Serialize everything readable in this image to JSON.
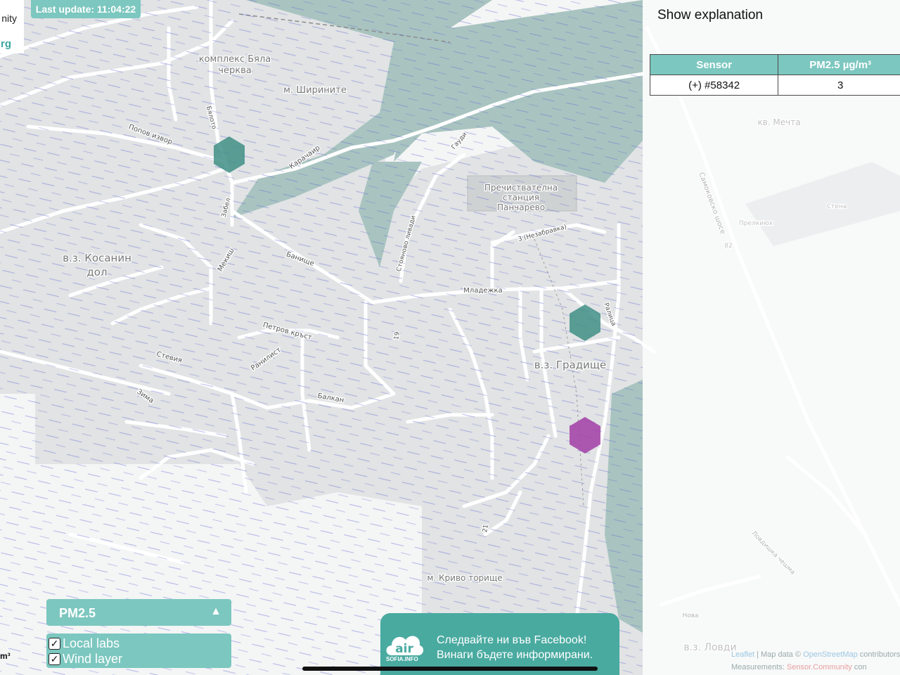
{
  "last_update": "Last update: 11:04:22",
  "info_box": {
    "line1": "nity",
    "line2": "rg"
  },
  "left_unit": "m³",
  "sidebar": {
    "show_explanation": "Show explanation",
    "table": {
      "headers": [
        "Sensor",
        "PM2.5 µg/m³"
      ],
      "rows": [
        [
          "(+) #58342",
          "3"
        ]
      ]
    }
  },
  "controls": {
    "pollutant": "PM2.5",
    "arrow": "▲",
    "layers": [
      {
        "label": "Local labs",
        "checked": true
      },
      {
        "label": "Wind layer",
        "checked": true
      }
    ]
  },
  "facebook": {
    "logo_text": "SOFIA.INFO",
    "line1": "Следвайте ни във Facebook!",
    "line2": "Винаги бъдете информирани."
  },
  "attribution": {
    "leaflet": "Leaflet",
    "sep": " | Map data © ",
    "osm": "OpenStreetMap",
    "contrib": " contributors",
    "measurements": "Measurements: ",
    "sc": "Sensor.Community",
    "sc_tail": " con"
  },
  "colors": {
    "accent": "#7cc7bf",
    "banner": "#49aaa0",
    "hex_green": "#3f8f86",
    "hex_purple": "#a23ea6",
    "forest": "#a9c4c0",
    "wind": "#5b63d6"
  },
  "map_labels": [
    {
      "text": "комплекс Бяла",
      "kind": "place"
    },
    {
      "text": "черква",
      "kind": "place"
    },
    {
      "text": "м. Ширините",
      "kind": "place"
    },
    {
      "text": "в.з. Косанин",
      "kind": "district"
    },
    {
      "text": "дол",
      "kind": "district"
    },
    {
      "text": "Пречиствателна",
      "kind": "place"
    },
    {
      "text": "станция",
      "kind": "place"
    },
    {
      "text": "Панчарево",
      "kind": "place"
    },
    {
      "text": "в.з. Градище",
      "kind": "district"
    },
    {
      "text": "м. Криво торище",
      "kind": "place"
    },
    {
      "text": "в.з. Ловди",
      "kind": "district"
    },
    {
      "text": "кв. Мечта",
      "kind": "place"
    },
    {
      "text": "Попов извор",
      "kind": "street"
    },
    {
      "text": "Карачаир",
      "kind": "street"
    },
    {
      "text": "Гауди",
      "kind": "street"
    },
    {
      "text": "Младежка",
      "kind": "street"
    },
    {
      "text": "Банище",
      "kind": "street"
    },
    {
      "text": "Мекиш",
      "kind": "street"
    },
    {
      "text": "Петров кръст",
      "kind": "street"
    },
    {
      "text": "Ранилист",
      "kind": "street"
    },
    {
      "text": "Стевия",
      "kind": "street"
    },
    {
      "text": "Зима",
      "kind": "street"
    },
    {
      "text": "Балкан",
      "kind": "street"
    },
    {
      "text": "Самоковско шосе",
      "kind": "street"
    },
    {
      "text": "3 (Незабравка)",
      "kind": "street"
    },
    {
      "text": "Ралица",
      "kind": "street"
    },
    {
      "text": "Стояново ливади",
      "kind": "street"
    },
    {
      "text": "Забел",
      "kind": "street"
    },
    {
      "text": "Бялото",
      "kind": "street"
    },
    {
      "text": "82",
      "kind": "road-number"
    },
    {
      "text": "19",
      "kind": "street"
    },
    {
      "text": "21",
      "kind": "street"
    },
    {
      "text": "Нова",
      "kind": "street"
    },
    {
      "text": "Ловдишка чешма",
      "kind": "street"
    },
    {
      "text": "Прелкиюх",
      "kind": "place"
    },
    {
      "text": "Стена",
      "kind": "place"
    }
  ]
}
